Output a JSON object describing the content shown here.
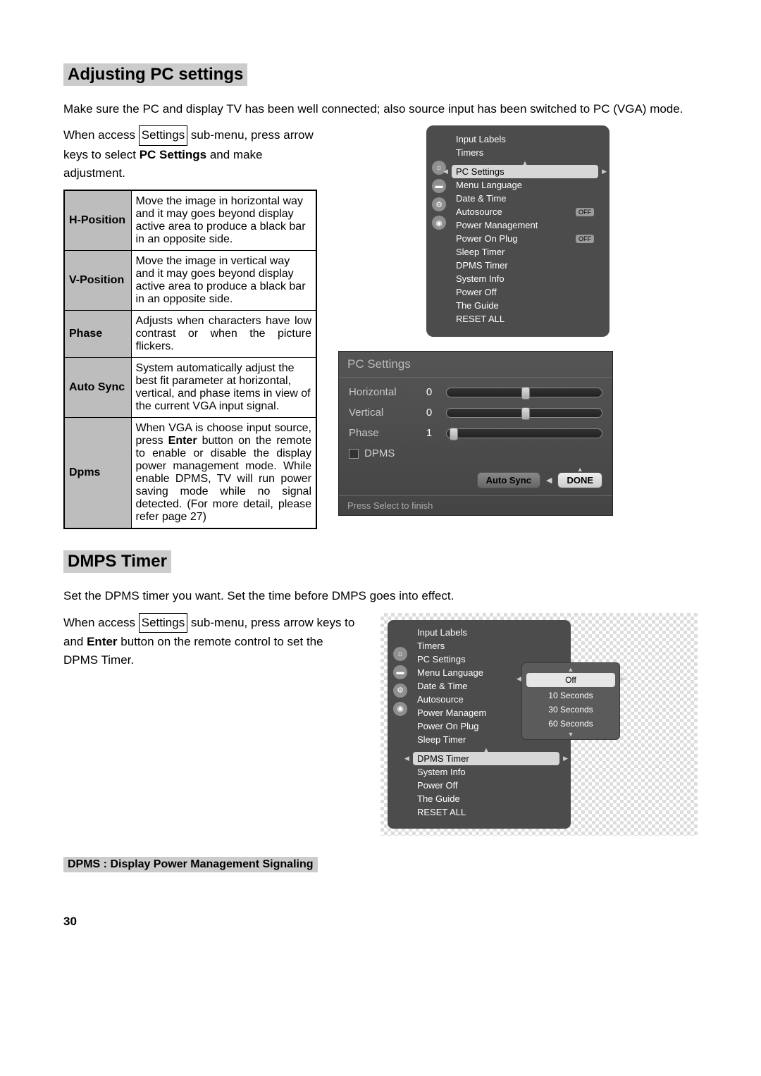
{
  "section1": {
    "title": "Adjusting PC settings",
    "intro": "Make sure the PC and display TV has been well connected; also source input has been switched to PC (VGA) mode.",
    "access_pre": "When access ",
    "settings_box": "Settings",
    "access_post": " sub-menu, press arrow keys to select ",
    "bold1": "PC Settings",
    "access_end": " and make adjustment."
  },
  "table": [
    {
      "term": "H-Position",
      "desc": "Move the image in horizontal way and it may goes beyond display active area to produce a black bar in an opposite side."
    },
    {
      "term": "V-Position",
      "desc": "Move the image in vertical way and it may goes beyond display active area to produce a black bar in an opposite side."
    },
    {
      "term": "Phase",
      "desc": "Adjusts when characters have low contrast or when the picture flickers."
    },
    {
      "term": "Auto Sync",
      "desc": "System automatically adjust the best fit parameter at horizontal, vertical, and phase items in view of the current VGA input signal."
    },
    {
      "term": "Dpms",
      "desc_pre": "When VGA is choose input source, press ",
      "desc_bold": "Enter",
      "desc_post": " button on the remote to enable or disable the display power management mode. While enable DPMS, TV will run power saving mode while no signal detected. (For more detail, please refer page 27)"
    }
  ],
  "tvmenu1": {
    "items": [
      "Input Labels",
      "Timers",
      "PC Settings",
      "Menu Language",
      "Date & Time",
      "Autosource",
      "Power Management",
      "Power On Plug",
      "Sleep Timer",
      "DPMS Timer",
      "System Info",
      "Power Off",
      "The Guide",
      "RESET ALL"
    ],
    "selected": "PC Settings",
    "off_items": [
      "Autosource",
      "Power On Plug"
    ]
  },
  "pc_dialog": {
    "title": "PC Settings",
    "rows": [
      {
        "label": "Horizontal",
        "value": "0",
        "thumb_pct": 48
      },
      {
        "label": "Vertical",
        "value": "0",
        "thumb_pct": 48
      },
      {
        "label": "Phase",
        "value": "1",
        "thumb_pct": 2
      }
    ],
    "dpms_label": "DPMS",
    "btn_auto": "Auto Sync",
    "btn_done": "DONE",
    "footer": "Press Select to finish"
  },
  "section2": {
    "title": "DMPS Timer",
    "intro": "Set the DPMS timer you want. Set the time before DMPS goes into effect.",
    "access_pre": "When access ",
    "settings_box": "Settings",
    "access_mid": " sub-menu, press arrow keys to and ",
    "bold1": "Enter",
    "access_end": " button on the remote control to set the DPMS Timer."
  },
  "tvmenu2": {
    "items": [
      "Input Labels",
      "Timers",
      "PC Settings",
      "Menu Language",
      "Date & Time",
      "Autosource",
      "Power Managem",
      "Power On Plug",
      "Sleep Timer",
      "DPMS Timer",
      "System Info",
      "Power Off",
      "The Guide",
      "RESET ALL"
    ],
    "selected": "DPMS Timer"
  },
  "dpms_popup": {
    "options": [
      "Off",
      "10 Seconds",
      "30 Seconds",
      "60 Seconds"
    ],
    "selected": "Off"
  },
  "footnote": "DPMS : Display Power Management Signaling",
  "page_number": "30"
}
